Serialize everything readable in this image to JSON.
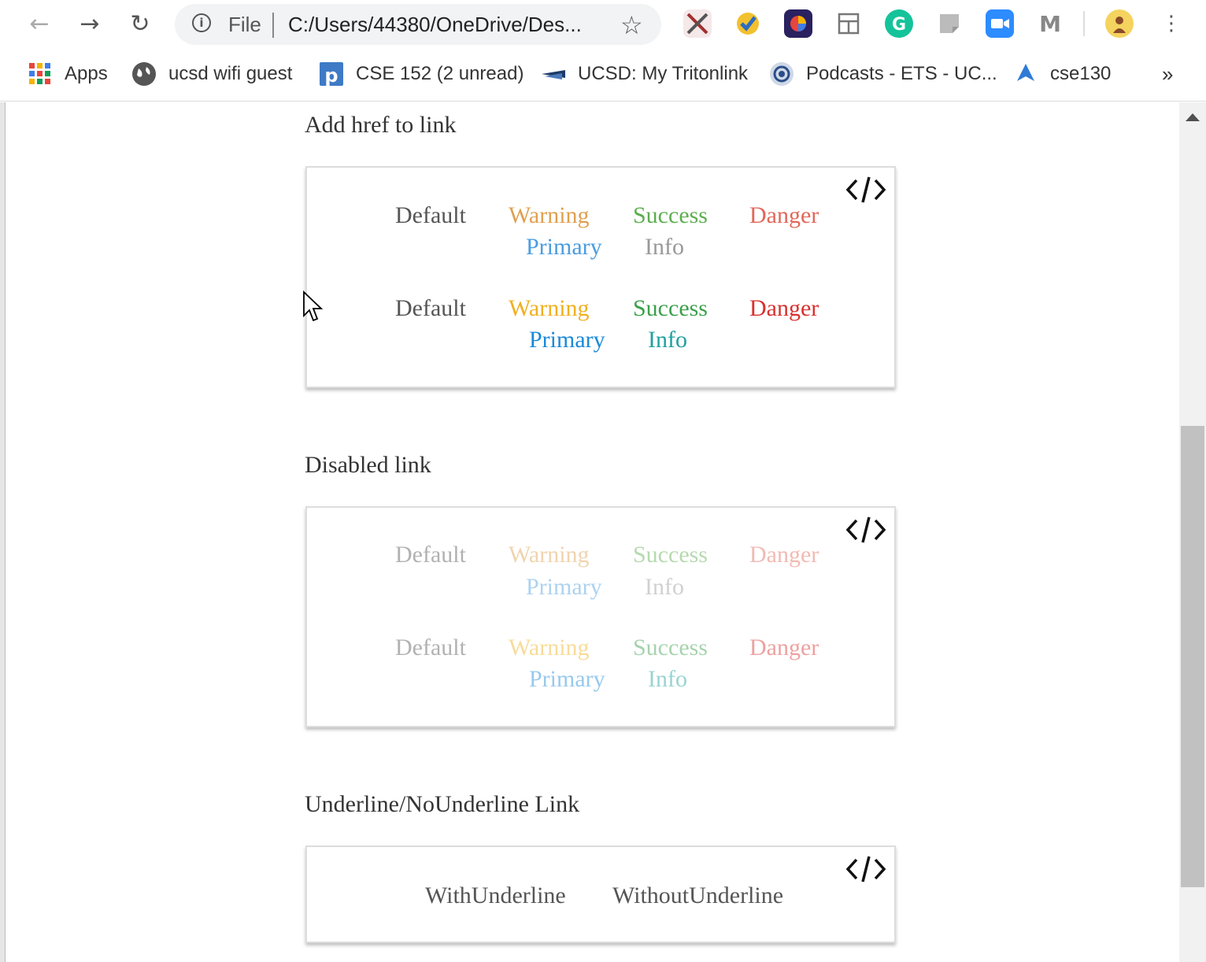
{
  "browser": {
    "address": {
      "scheme_label": "File",
      "url": "C:/Users/44380/OneDrive/Des..."
    },
    "bookmarks": [
      {
        "label": "Apps",
        "icon": "apps-grid-icon"
      },
      {
        "label": "ucsd wifi guest",
        "icon": "globe-icon"
      },
      {
        "label": "CSE 152 (2 unread)",
        "icon": "piazza-icon"
      },
      {
        "label": "UCSD: My Tritonlink",
        "icon": "tritonlink-icon"
      },
      {
        "label": "Podcasts - ETS - UC...",
        "icon": "podcast-icon"
      },
      {
        "label": "cse130",
        "icon": "cse130-icon"
      }
    ],
    "overflow_label": "»"
  },
  "sections": {
    "href": {
      "title": "Add href to link",
      "row1": [
        "Default",
        "Warning",
        "Success",
        "Danger"
      ],
      "row2": [
        "Primary",
        "Info"
      ],
      "row3": [
        "Default",
        "Warning",
        "Success",
        "Danger"
      ],
      "row4": [
        "Primary",
        "Info"
      ]
    },
    "disabled": {
      "title": "Disabled link",
      "row1": [
        "Default",
        "Warning",
        "Success",
        "Danger"
      ],
      "row2": [
        "Primary",
        "Info"
      ],
      "row3": [
        "Default",
        "Warning",
        "Success",
        "Danger"
      ],
      "row4": [
        "Primary",
        "Info"
      ]
    },
    "underline": {
      "title": "Underline/NoUnderline Link",
      "with": "WithUnderline",
      "without": "WithoutUnderline"
    }
  },
  "colors": {
    "default": "#555555",
    "warning_muted": "#e0a050",
    "success_muted": "#5cae4e",
    "danger_muted": "#e2675a",
    "primary_muted": "#4a9de0",
    "info_muted": "#999999",
    "warning": "#f0b020",
    "success": "#3aa04a",
    "danger": "#d8312f",
    "primary": "#1a8ad8",
    "info": "#20a0a0"
  }
}
